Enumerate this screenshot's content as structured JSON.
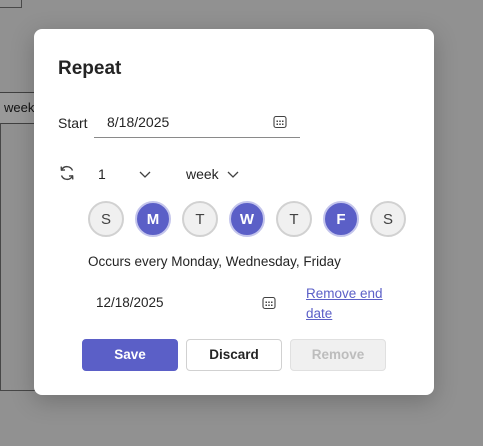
{
  "background": {
    "field_text": "week"
  },
  "dialog": {
    "title": "Repeat",
    "start": {
      "label": "Start",
      "value": "8/18/2025",
      "icon": "calendar-icon"
    },
    "recurrence": {
      "icon": "repeat-icon",
      "interval": "1",
      "unit": "week"
    },
    "days": [
      {
        "label": "S",
        "selected": false
      },
      {
        "label": "M",
        "selected": true
      },
      {
        "label": "T",
        "selected": false
      },
      {
        "label": "W",
        "selected": true
      },
      {
        "label": "T",
        "selected": false
      },
      {
        "label": "F",
        "selected": true
      },
      {
        "label": "S",
        "selected": false
      }
    ],
    "summary": "Occurs every Monday, Wednesday, Friday",
    "end": {
      "value": "12/18/2025",
      "icon": "calendar-icon",
      "remove_link": "Remove end date"
    },
    "buttons": {
      "save": "Save",
      "discard": "Discard",
      "remove": "Remove"
    }
  },
  "colors": {
    "accent": "#5b5fc7",
    "day_selected_ring": "#c4c5ec",
    "day_unselected_bg": "#f0f0f0"
  }
}
